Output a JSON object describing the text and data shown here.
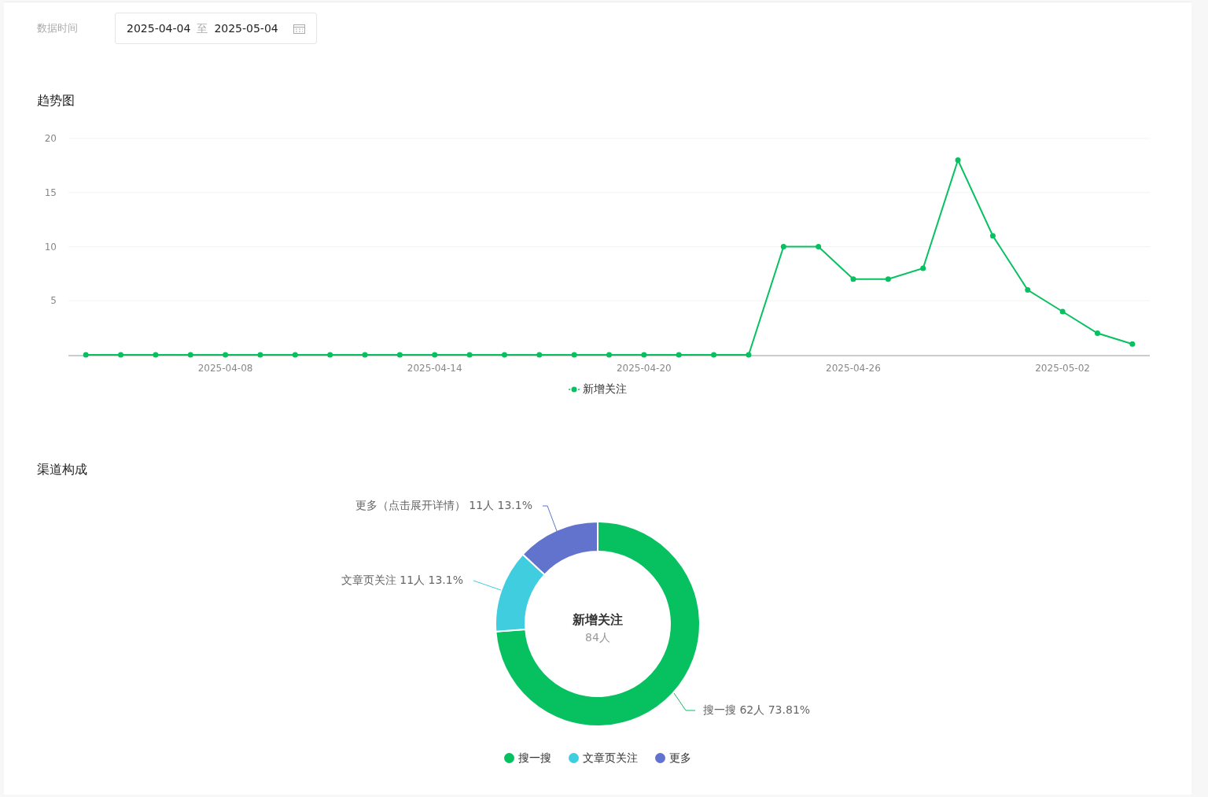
{
  "filter": {
    "label": "数据时间",
    "start": "2025-04-04",
    "separator": "至",
    "end": "2025-05-04"
  },
  "trend": {
    "title": "趋势图",
    "chart_data": {
      "type": "line",
      "grid": true,
      "categories": [
        null,
        null,
        null,
        null,
        "2025-04-08",
        null,
        null,
        null,
        null,
        null,
        "2025-04-14",
        null,
        null,
        null,
        null,
        null,
        "2025-04-20",
        null,
        null,
        null,
        null,
        null,
        "2025-04-26",
        null,
        null,
        null,
        null,
        null,
        "2025-05-02",
        null,
        null
      ],
      "series": [
        {
          "name": "新增关注",
          "color": "#07c160",
          "marker": "circle",
          "values": [
            0,
            0,
            0,
            0,
            0,
            0,
            0,
            0,
            0,
            0,
            0,
            0,
            0,
            0,
            0,
            0,
            0,
            0,
            0,
            0,
            10,
            10,
            7,
            7,
            8,
            18,
            11,
            6,
            4,
            2,
            1
          ]
        }
      ],
      "ylim": [
        0,
        20
      ],
      "yticks": [
        5,
        10,
        15,
        20
      ]
    }
  },
  "channels": {
    "title": "渠道构成",
    "center_title": "新增关注",
    "center_value": "84人",
    "slice_labels": [
      "更多（点击展开详情） 11人 13.1%",
      "文章页关注 11人 13.1%",
      "搜一搜 62人 73.81%"
    ],
    "legend": [
      {
        "color": "#07c160"
      },
      {
        "color": "#40cde0"
      },
      {
        "color": "#6173cc"
      }
    ],
    "chart_data": {
      "type": "donut",
      "categories": [
        "搜一搜",
        "文章页关注",
        "更多"
      ],
      "values": [
        73.8,
        13.1,
        13.1
      ]
    }
  }
}
